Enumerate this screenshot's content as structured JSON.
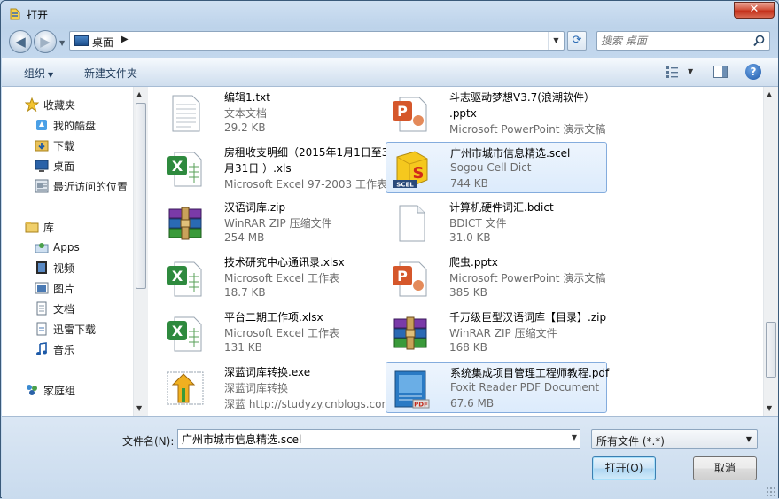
{
  "window": {
    "title": "打开",
    "close_label": "✕"
  },
  "address": {
    "location": "桌面",
    "separator": "▶"
  },
  "search": {
    "placeholder": "搜索 桌面"
  },
  "toolbar": {
    "organize_label": "组织",
    "new_folder_label": "新建文件夹"
  },
  "nav": {
    "favorites_label": "收藏夹",
    "favorites": [
      "我的酷盘",
      "下载",
      "桌面",
      "最近访问的位置"
    ],
    "libraries_label": "库",
    "libraries": [
      "Apps",
      "视频",
      "图片",
      "文档",
      "迅雷下载",
      "音乐"
    ],
    "homegroup_label": "家庭组"
  },
  "files": [
    {
      "name": "编辑1.txt",
      "type": "文本文档",
      "size": "29.2 KB",
      "icon": "text-file-icon"
    },
    {
      "name": "斗志驱动梦想V3.7(浪潮软件）",
      "name2": ".pptx",
      "type": "Microsoft PowerPoint 演示文稿",
      "icon": "powerpoint-icon"
    },
    {
      "name": "房租收支明细（2015年1月1日至3",
      "name2": "月31日 ）.xls",
      "type": "Microsoft Excel 97-2003 工作表",
      "icon": "excel-icon"
    },
    {
      "name": "广州市城市信息精选.scel",
      "type": "Sogou Cell Dict",
      "size": "744 KB",
      "icon": "scel-icon"
    },
    {
      "name": "汉语词库.zip",
      "type": "WinRAR ZIP 压缩文件",
      "size": "254 MB",
      "icon": "winrar-icon"
    },
    {
      "name": "计算机硬件词汇.bdict",
      "type": "BDICT 文件",
      "size": "31.0 KB",
      "icon": "blank-file-icon"
    },
    {
      "name": "技术研究中心通讯录.xlsx",
      "type": "Microsoft Excel 工作表",
      "size": "18.7 KB",
      "icon": "excel-icon"
    },
    {
      "name": "爬虫.pptx",
      "type": "Microsoft PowerPoint 演示文稿",
      "size": "385 KB",
      "icon": "powerpoint-icon"
    },
    {
      "name": "平台二期工作项.xlsx",
      "type": "Microsoft Excel 工作表",
      "size": "131 KB",
      "icon": "excel-icon"
    },
    {
      "name": "千万级巨型汉语词库【目录】.zip",
      "type": "WinRAR ZIP 压缩文件",
      "size": "168 KB",
      "icon": "winrar-icon"
    },
    {
      "name": "深蓝词库转换.exe",
      "type": "深蓝词库转换",
      "size": "深蓝 http://studyzy.cnblogs.com",
      "icon": "exe-icon"
    },
    {
      "name": "系统集成项目管理工程师教程.pdf",
      "type": "Foxit Reader PDF Document",
      "size": "67.6 MB",
      "icon": "pdf-icon"
    }
  ],
  "bottom": {
    "filename_label": "文件名(N):",
    "filename_value": "广州市城市信息精选.scel",
    "filetype_value": "所有文件 (*.*)",
    "open_label": "打开(O)",
    "cancel_label": "取消"
  }
}
